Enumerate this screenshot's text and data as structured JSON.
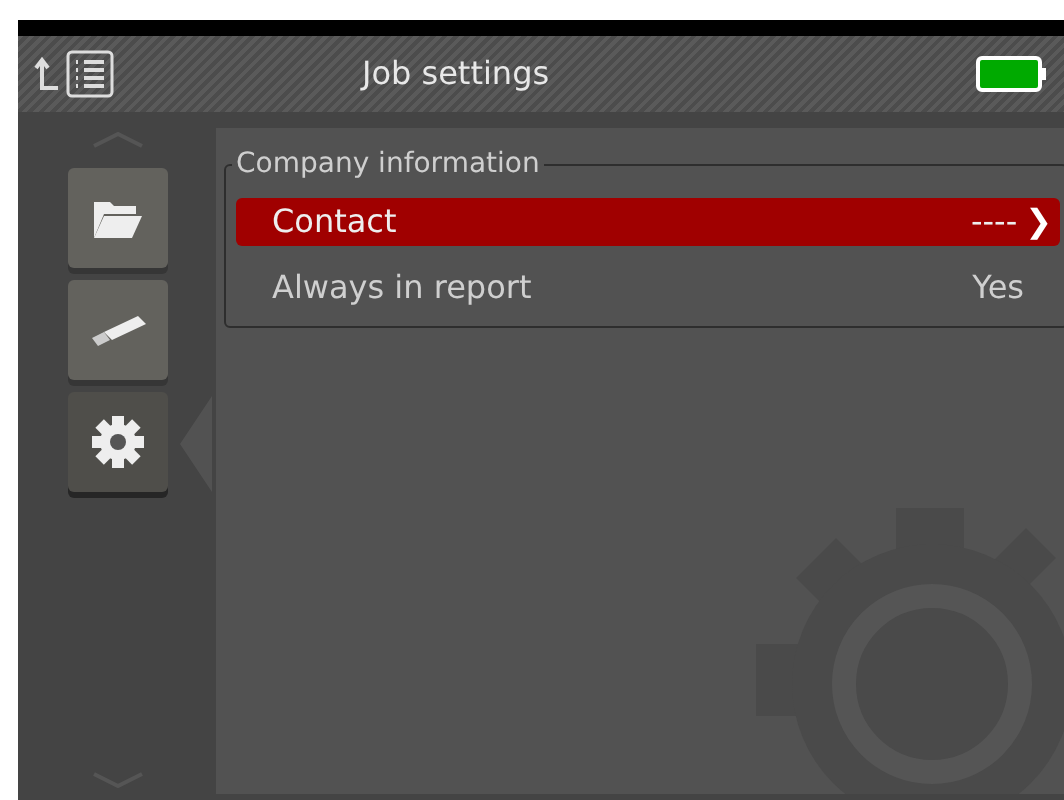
{
  "header": {
    "title": "Job settings"
  },
  "sidebar": {
    "items": [
      {
        "kind": "folder",
        "selected": false
      },
      {
        "kind": "usb",
        "selected": false
      },
      {
        "kind": "settings",
        "selected": true
      }
    ]
  },
  "group": {
    "title": "Company information",
    "rows": [
      {
        "label": "Contact",
        "value": "----",
        "chevron": "❯",
        "selected": true
      },
      {
        "label": "Always in report",
        "value": "Yes",
        "selected": false
      }
    ]
  }
}
